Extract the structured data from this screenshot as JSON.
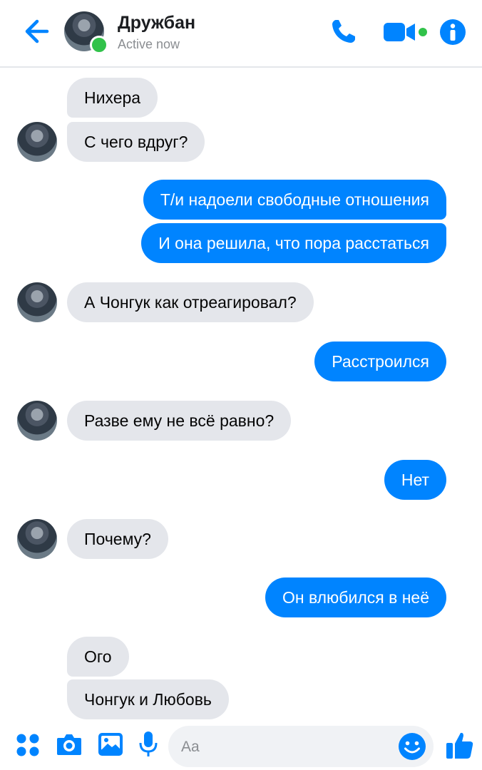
{
  "header": {
    "contact_name": "Дружбан",
    "status": "Active now",
    "icons": [
      "back-arrow-icon",
      "phone-icon",
      "video-camera-icon",
      "info-icon"
    ],
    "accent_color": "#0084ff",
    "online_color": "#31c24a"
  },
  "messages": [
    {
      "side": "in",
      "text": "Нихера"
    },
    {
      "side": "in",
      "text": "С чего вдруг?"
    },
    {
      "side": "out",
      "text": "Т/и надоели свободные отношения"
    },
    {
      "side": "out",
      "text": "И она решила, что пора расстаться"
    },
    {
      "side": "in",
      "text": "А Чонгук как отреагировал?"
    },
    {
      "side": "out",
      "text": "Расстроился"
    },
    {
      "side": "in",
      "text": "Разве ему не всё равно?"
    },
    {
      "side": "out",
      "text": "Нет"
    },
    {
      "side": "in",
      "text": "Почему?"
    },
    {
      "side": "out",
      "text": "Он влюбился в неё"
    },
    {
      "side": "in",
      "text": "Ого"
    },
    {
      "side": "in",
      "text": "Чонгук и Любовь"
    }
  ],
  "composer": {
    "placeholder": "Aa",
    "icons": [
      "apps-icon",
      "camera-icon",
      "gallery-icon",
      "microphone-icon",
      "emoji-icon",
      "thumbs-up-icon"
    ]
  }
}
